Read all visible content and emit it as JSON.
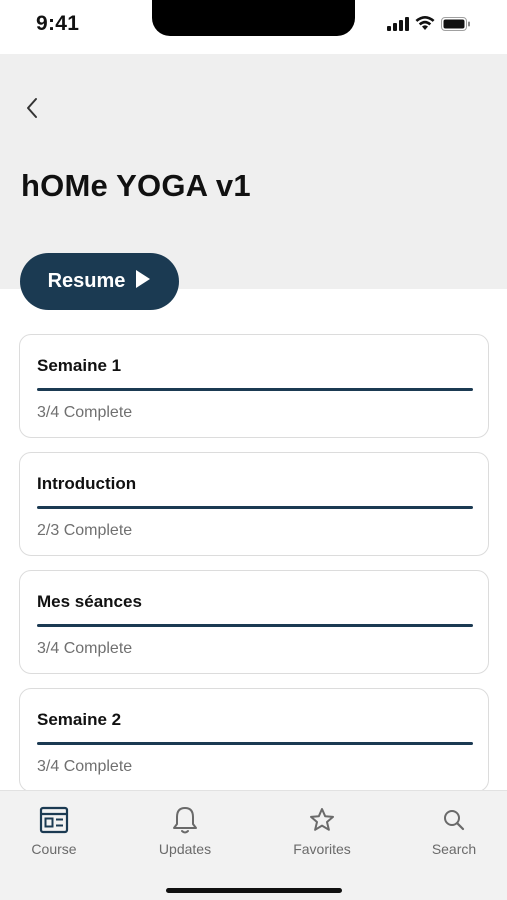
{
  "status_bar": {
    "time": "9:41"
  },
  "header": {
    "title": "hOMe YOGA v1",
    "back_icon": "chevron-left-icon"
  },
  "resume": {
    "label": "Resume",
    "icon": "play-icon",
    "color": "#1b3a52"
  },
  "sections": [
    {
      "title": "Semaine 1",
      "status": "3/4 Complete"
    },
    {
      "title": "Introduction",
      "status": "2/3 Complete"
    },
    {
      "title": "Mes séances",
      "status": "3/4 Complete"
    },
    {
      "title": "Semaine 2",
      "status": "3/4 Complete"
    }
  ],
  "tab_bar": {
    "tabs": [
      {
        "label": "Course",
        "icon": "course-icon",
        "active": true
      },
      {
        "label": "Updates",
        "icon": "bell-icon",
        "active": false
      },
      {
        "label": "Favorites",
        "icon": "star-icon",
        "active": false
      },
      {
        "label": "Search",
        "icon": "search-icon",
        "active": false
      }
    ],
    "active_color": "#1b3a52",
    "inactive_color": "#6a6a6a"
  }
}
